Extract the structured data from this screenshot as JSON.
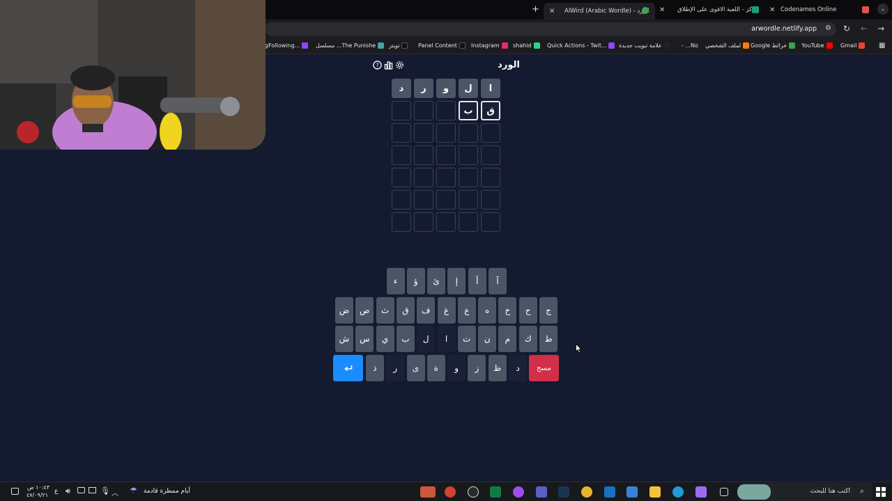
{
  "browser": {
    "tabs": [
      {
        "title": "Codenames Online",
        "favicon": "codenames-favicon"
      },
      {
        "title": "ركز - اللعبة الاقوى على الإطلاق",
        "favicon": "rakkez-favicon"
      },
      {
        "title": "AlWird (Arabic Wordle) - الورد",
        "favicon": "alwird-favicon"
      }
    ],
    "new_tab": "+",
    "url": "arwordle.netlify.app",
    "bookmarks": [
      {
        "label": "Gmail",
        "color": "#ea4335"
      },
      {
        "label": "YouTube",
        "color": "#ff0000"
      },
      {
        "label": "Google خرائط",
        "color": "#34a853"
      },
      {
        "label": "لملف الشخصي",
        "color": "#ff7a00"
      },
      {
        "label": "- ...No",
        "color": "#333333"
      },
      {
        "label": "علامة تبويب جديدة",
        "color": "#222222"
      },
      {
        "label": "Quick Actions - Twit...",
        "color": "#9146ff"
      },
      {
        "label": "shahid",
        "color": "#2cd48a"
      },
      {
        "label": "Instagram",
        "color": "#e1306c"
      },
      {
        "label": "Panel Content",
        "color": "#111111"
      },
      {
        "label": "تويتر",
        "color": "#111111"
      },
      {
        "label": "مسلسل ...The Punishe",
        "color": "#4aa3a0"
      },
      {
        "label": "gFollowing...",
        "color": "#9146ff"
      }
    ]
  },
  "game": {
    "title": "الورد",
    "board": [
      [
        "ا",
        "ل",
        "و",
        "ر",
        "د"
      ],
      [
        "ق",
        "ب",
        "",
        "",
        ""
      ],
      [
        "",
        "",
        "",
        "",
        ""
      ],
      [
        "",
        "",
        "",
        "",
        ""
      ],
      [
        "",
        "",
        "",
        "",
        ""
      ],
      [
        "",
        "",
        "",
        "",
        ""
      ],
      [
        "",
        "",
        "",
        "",
        ""
      ]
    ],
    "keyboard": {
      "row1": [
        "آ",
        "أ",
        "إ",
        "ئ",
        "ؤ",
        "ء"
      ],
      "row2": [
        "ج",
        "ح",
        "خ",
        "ه",
        "ع",
        "غ",
        "ف",
        "ق",
        "ث",
        "ص",
        "ض"
      ],
      "row3": [
        "ط",
        "ك",
        "م",
        "ن",
        "ت",
        "ا",
        "ل",
        "ب",
        "ي",
        "س",
        "ش"
      ],
      "row4": [
        "د",
        "ظ",
        "ز",
        "و",
        "ة",
        "ى",
        "ر",
        "ذ"
      ],
      "enter_icon": "enter-icon",
      "delete_label": "مسح"
    },
    "colors": {
      "background": "#141a2f",
      "key": "#4b5566",
      "key_used": "#1a2035",
      "enter": "#1a8cff",
      "delete": "#d12f47"
    }
  },
  "taskbar": {
    "search_placeholder": "اكتب هنا للبحث",
    "weather": "أيام ممطرة قادمة",
    "lang": "ع",
    "time": "١٠:٤٣ ص",
    "date": "٤٧/٠٩/٢١"
  }
}
